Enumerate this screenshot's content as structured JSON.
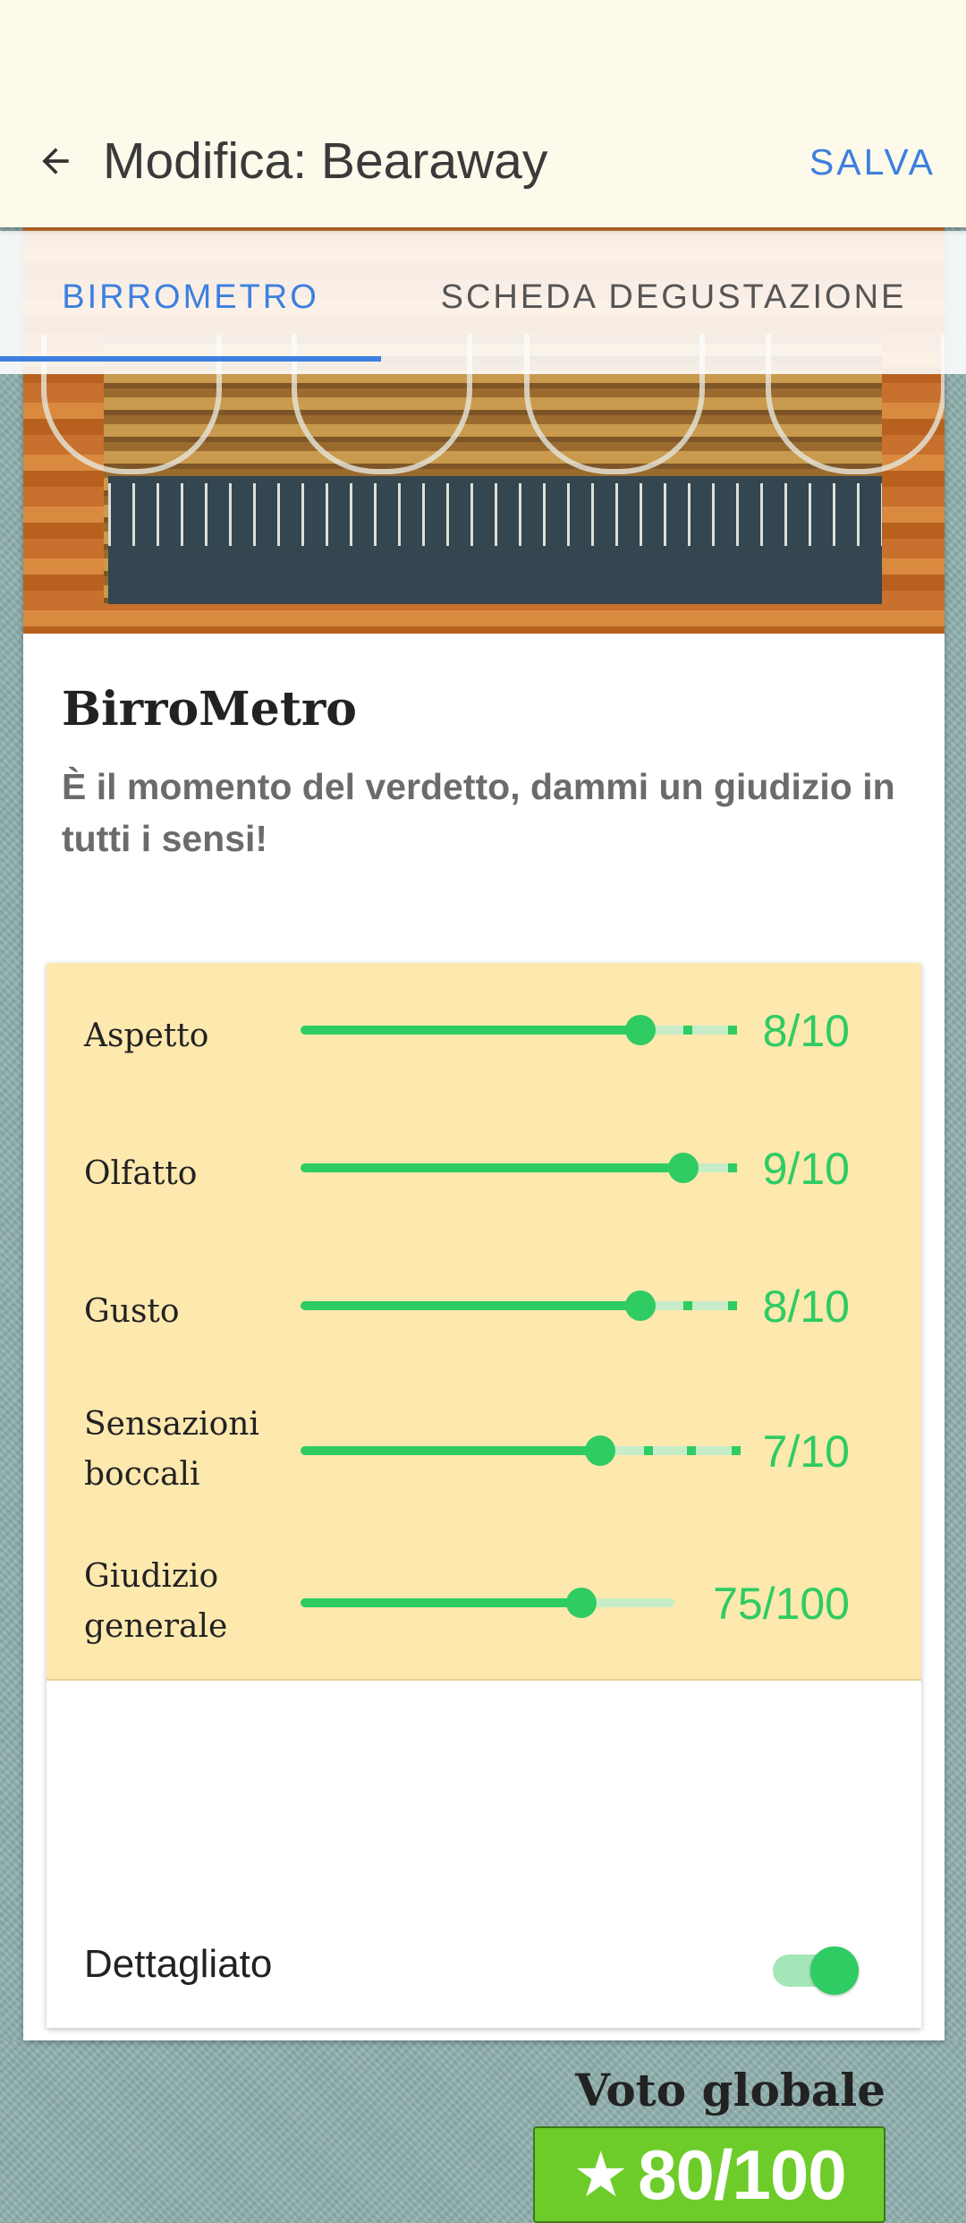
{
  "appbar": {
    "title": "Modifica: Bearaway",
    "save_label": "SALVA"
  },
  "tabs": [
    {
      "label": "BIRROMETRO",
      "selected": true
    },
    {
      "label": "SCHEDA DEGUSTAZIONE",
      "selected": false
    }
  ],
  "card": {
    "title": "BirroMetro",
    "subtitle": "È il momento del verdetto, dammi un giudizio in tutti i sensi!"
  },
  "ratings": [
    {
      "label": "Aspetto",
      "score": "8/10",
      "value": 8,
      "max": 10
    },
    {
      "label": "Olfatto",
      "score": "9/10",
      "value": 9,
      "max": 10
    },
    {
      "label": "Gusto",
      "score": "8/10",
      "value": 8,
      "max": 10
    },
    {
      "label": "Sensazioni boccali",
      "score": "7/10",
      "value": 7,
      "max": 10
    },
    {
      "label": "Giudizio generale",
      "score": "75/100",
      "value": 75,
      "max": 100
    }
  ],
  "detail": {
    "label": "Dettagliato",
    "enabled": true
  },
  "overall": {
    "label": "Voto globale",
    "star": "★",
    "value": "80/100"
  },
  "colors": {
    "accent": "#3d7fe0",
    "green": "#2ecc63",
    "row_bg": "#fde8ae",
    "badge": "#6dcc2a"
  },
  "icons": {
    "back": "arrow-left-icon",
    "star": "star-icon"
  }
}
